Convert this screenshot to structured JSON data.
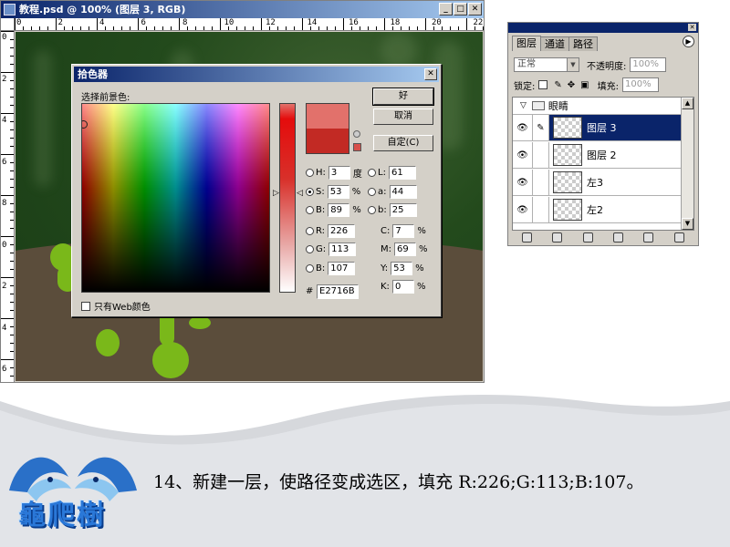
{
  "document_window": {
    "title": "教程.psd @ 100% (图层 3, RGB)",
    "ruler_top_labels": [
      "0",
      "2",
      "4",
      "6",
      "8",
      "10",
      "12",
      "14",
      "16",
      "18",
      "20",
      "22"
    ],
    "ruler_left_labels": [
      "0",
      "2",
      "4",
      "6",
      "8",
      "0",
      "2",
      "4",
      "6"
    ]
  },
  "color_picker": {
    "title": "拾色器",
    "prompt": "选择前景色:",
    "buttons": {
      "ok": "好",
      "cancel": "取消",
      "custom": "自定(C)"
    },
    "hsb": [
      {
        "label": "H:",
        "value": "3",
        "unit": "度",
        "selected": false
      },
      {
        "label": "S:",
        "value": "53",
        "unit": "%",
        "selected": true
      },
      {
        "label": "B:",
        "value": "89",
        "unit": "%",
        "selected": false
      }
    ],
    "lab": [
      {
        "label": "L:",
        "value": "61"
      },
      {
        "label": "a:",
        "value": "44"
      },
      {
        "label": "b:",
        "value": "25"
      }
    ],
    "rgb": [
      {
        "label": "R:",
        "value": "226"
      },
      {
        "label": "G:",
        "value": "113"
      },
      {
        "label": "B:",
        "value": "107"
      }
    ],
    "cmyk": [
      {
        "label": "C:",
        "value": "7",
        "unit": "%"
      },
      {
        "label": "M:",
        "value": "69",
        "unit": "%"
      },
      {
        "label": "Y:",
        "value": "53",
        "unit": "%"
      },
      {
        "label": "K:",
        "value": "0",
        "unit": "%"
      }
    ],
    "hex_label": "#",
    "hex_value": "E2716B",
    "web_only_label": "只有Web颜色",
    "new_color": "#e2716b",
    "old_color": "#c22a24"
  },
  "layers_panel": {
    "tabs": [
      "图层",
      "通道",
      "路径"
    ],
    "blend_mode": "正常",
    "opacity_label": "不透明度:",
    "opacity_value": "100%",
    "lock_label": "锁定:",
    "fill_label": "填充:",
    "fill_value": "100%",
    "group_name": "眼睛",
    "layers": [
      {
        "name": "图层 3",
        "selected": true
      },
      {
        "name": "图层 2",
        "selected": false
      },
      {
        "name": "左3",
        "selected": false
      },
      {
        "name": "左2",
        "selected": false
      }
    ]
  },
  "caption": "14、新建一层，使路径变成选区，填充 R:226;G:113;B:107。",
  "logo_text": "龜爬樹",
  "colors": {
    "titlebar": "#0a246a",
    "selection": "#0a246a",
    "canvas_green": "#234a1c",
    "ground_brown": "#5b4d3b",
    "frog_green": "#7ab81a",
    "logo_blue": "#2a78d8"
  }
}
